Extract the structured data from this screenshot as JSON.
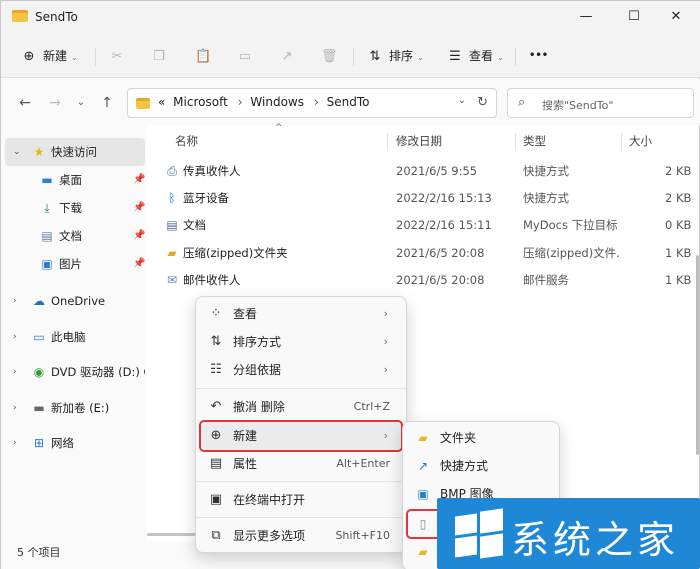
{
  "window": {
    "title": "SendTo",
    "minimize_glyph": "—",
    "maximize_glyph": "☐",
    "close_glyph": "✕"
  },
  "toolbar": {
    "new_label": "新建",
    "sort_label": "排序",
    "view_label": "查看",
    "more_glyph": "•••"
  },
  "address": {
    "overflow": "«",
    "crumbs": [
      "Microsoft",
      "Windows",
      "SendTo"
    ],
    "search_placeholder": "搜索\"SendTo\""
  },
  "nav": {
    "quick_access": "快速访问",
    "desktop": "桌面",
    "downloads": "下载",
    "documents": "文档",
    "pictures": "图片",
    "onedrive": "OneDrive",
    "this_pc": "此电脑",
    "dvd": "DVD 驱动器 (D:) CC",
    "new_volume": "新加卷 (E:)",
    "network": "网络"
  },
  "columns": {
    "name": "名称",
    "date": "修改日期",
    "type": "类型",
    "size": "大小"
  },
  "files": [
    {
      "name": "传真收件人",
      "date": "2021/6/5 9:55",
      "type": "快捷方式",
      "size": "2 KB",
      "icon": "fax-icon"
    },
    {
      "name": "蓝牙设备",
      "date": "2022/2/16 15:13",
      "type": "快捷方式",
      "size": "2 KB",
      "icon": "bluetooth-icon"
    },
    {
      "name": "文档",
      "date": "2022/2/16 15:11",
      "type": "MyDocs Drop Target",
      "type_display": "MyDocs 下拉目标",
      "size": "0 KB",
      "icon": "document-icon"
    },
    {
      "name": "压缩(zipped)文件夹",
      "date": "2021/6/5 20:08",
      "type": "压缩(zipped)文件...",
      "size": "1 KB",
      "icon": "zip-folder-icon"
    },
    {
      "name": "邮件收件人",
      "date": "2021/6/5 20:08",
      "type": "邮件服务",
      "size": "1 KB",
      "icon": "mail-icon"
    }
  ],
  "status": {
    "count": "5 个项目"
  },
  "context_menu": {
    "view": "查看",
    "sort": "排序方式",
    "group": "分组依据",
    "undo": "撤消 删除",
    "undo_shortcut": "Ctrl+Z",
    "new": "新建",
    "properties": "属性",
    "properties_shortcut": "Alt+Enter",
    "terminal": "在终端中打开",
    "more": "显示更多选项",
    "more_shortcut": "Shift+F10"
  },
  "submenu": {
    "folder": "文件夹",
    "shortcut": "快捷方式",
    "bmp": "BMP 图像"
  },
  "watermark": {
    "text": "系统之家"
  },
  "colors": {
    "accent": "#0067c0",
    "highlight_border": "#e3343a",
    "folder": "#f3c443",
    "watermark_bg": "#1e88d6"
  }
}
